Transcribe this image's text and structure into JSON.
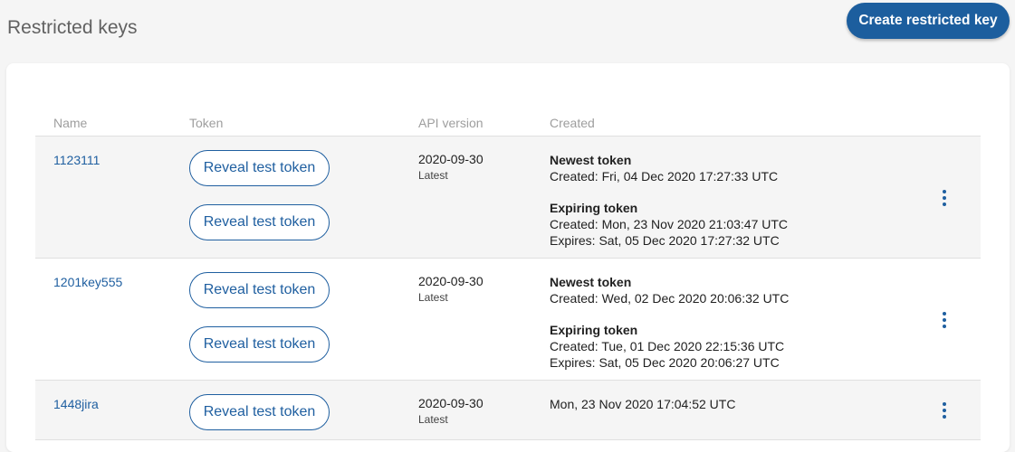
{
  "page": {
    "title": "Restricted keys",
    "create_button": "Create restricted key"
  },
  "table": {
    "columns": [
      "Name",
      "Token",
      "API version",
      "Created"
    ],
    "rows": [
      {
        "name": "1123111",
        "tokens": [
          "Reveal test token",
          "Reveal test token"
        ],
        "api_version": "2020-09-30",
        "api_tag": "Latest",
        "newest_label": "Newest token",
        "newest_created": "Created: Fri, 04 Dec 2020 17:27:33 UTC",
        "expiring_label": "Expiring token",
        "expiring_created": "Created: Mon, 23 Nov 2020 21:03:47 UTC",
        "expiring_expires": "Expires: Sat, 05 Dec 2020 17:27:32 UTC"
      },
      {
        "name": "1201key555",
        "tokens": [
          "Reveal test token",
          "Reveal test token"
        ],
        "api_version": "2020-09-30",
        "api_tag": "Latest",
        "newest_label": "Newest token",
        "newest_created": "Created: Wed, 02 Dec 2020 20:06:32 UTC",
        "expiring_label": "Expiring token",
        "expiring_created": "Created: Tue, 01 Dec 2020 22:15:36 UTC",
        "expiring_expires": "Expires: Sat, 05 Dec 2020 20:06:27 UTC"
      },
      {
        "name": "1448jira",
        "tokens": [
          "Reveal test token"
        ],
        "api_version": "2020-09-30",
        "api_tag": "Latest",
        "created": "Mon, 23 Nov 2020 17:04:52 UTC"
      }
    ]
  },
  "icons": {
    "row_menu": "more-vertical-icon"
  },
  "colors": {
    "primary": "#1c5e9e",
    "link": "#1f5fa0",
    "row_alt_bg": "#f5f5f5",
    "page_bg": "#f5f5f5"
  }
}
